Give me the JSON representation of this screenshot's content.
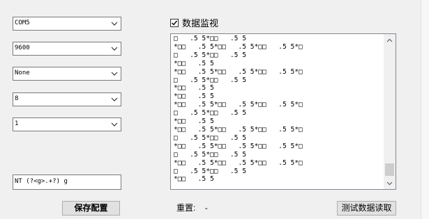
{
  "settings": {
    "port": "COM5",
    "baud_rate": "9600",
    "parity": "None",
    "data_bits": "8",
    "stop_bits": "1",
    "regex": "NT (?<g>.+?) g"
  },
  "buttons": {
    "save": "保存配置",
    "test_read": "测试数据读取"
  },
  "monitor": {
    "checkbox_label": "数据监视",
    "checked": true,
    "content": "□   .5 5*□□   .5 5\n*□□   .5 5*□□   .5 5*□□   .5 5*□\n□   .5 5*□□   .5 5\n*□□   .5 5\n*□□   .5 5*□□   .5 5*□□   .5 5*□\n□   .5 5*□□   .5 5\n*□□   .5 5\n*□□   .5 5\n*□□   .5 5*□□   .5 5*□□   .5 5*□\n□   .5 5*□□   .5 5\n*□□   .5 5\n*□□   .5 5*□□   .5 5*□□   .5 5*□\n□   .5 5*□□   .5 5\n*□□   .5 5*□□   .5 5*□□   .5 5*□\n□   .5 5*□□   .5 5\n*□□   .5 5*□□   .5 5*□□   .5 5*□\n□   .5 5*□□   .5 5\n*□□   .5 5"
  },
  "status": {
    "retry_label": "重置:",
    "retry_value": "-"
  }
}
